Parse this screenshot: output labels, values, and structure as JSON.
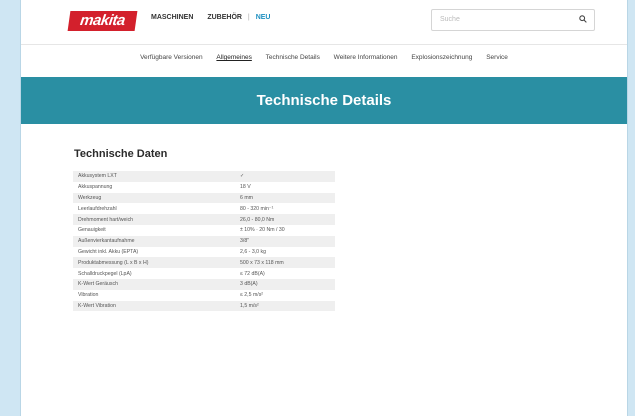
{
  "header": {
    "logo_text": "makita",
    "nav": [
      {
        "label": "MASCHINEN",
        "active": false
      },
      {
        "label": "ZUBEHÖR",
        "active": false
      },
      {
        "label": "NEU",
        "active": true
      }
    ],
    "search": {
      "placeholder": "Suche"
    }
  },
  "subnav": [
    {
      "label": "Verfügbare Versionen",
      "active": false
    },
    {
      "label": "Allgemeines",
      "active": true
    },
    {
      "label": "Technische Details",
      "active": false
    },
    {
      "label": "Weitere Informationen",
      "active": false
    },
    {
      "label": "Explosionszeichnung",
      "active": false
    },
    {
      "label": "Service",
      "active": false
    }
  ],
  "hero": {
    "title": "Technische Details"
  },
  "specs": {
    "title": "Technische Daten",
    "rows": [
      {
        "label": "Akkusystem LXT",
        "value": "✓"
      },
      {
        "label": "Akkuspannung",
        "value": "18 V"
      },
      {
        "label": "Werkzeug",
        "value": "6 mm"
      },
      {
        "label": "Leerlaufdrehzahl",
        "value": "80 - 320 min⁻¹"
      },
      {
        "label": "Drehmoment hart/weich",
        "value": "26,0 - 80,0 Nm"
      },
      {
        "label": "Genauigkeit",
        "value": "± 10% · 20 Nm / 30"
      },
      {
        "label": "Außenvierkantaufnahme",
        "value": "3/8\""
      },
      {
        "label": "Gewicht inkl. Akku (EPTA)",
        "value": "2,6 - 3,0 kg"
      },
      {
        "label": "Produktabmessung (L x B x H)",
        "value": "500 x 73 x 118 mm"
      },
      {
        "label": "Schalldruckpegel (LpA)",
        "value": "≤ 72 dB(A)"
      },
      {
        "label": "K-Wert Geräusch",
        "value": "3 dB(A)"
      },
      {
        "label": "Vibration",
        "value": "≤ 2,5 m/s²"
      },
      {
        "label": "K-Wert Vibration",
        "value": "1,5 m/s²"
      }
    ]
  }
}
